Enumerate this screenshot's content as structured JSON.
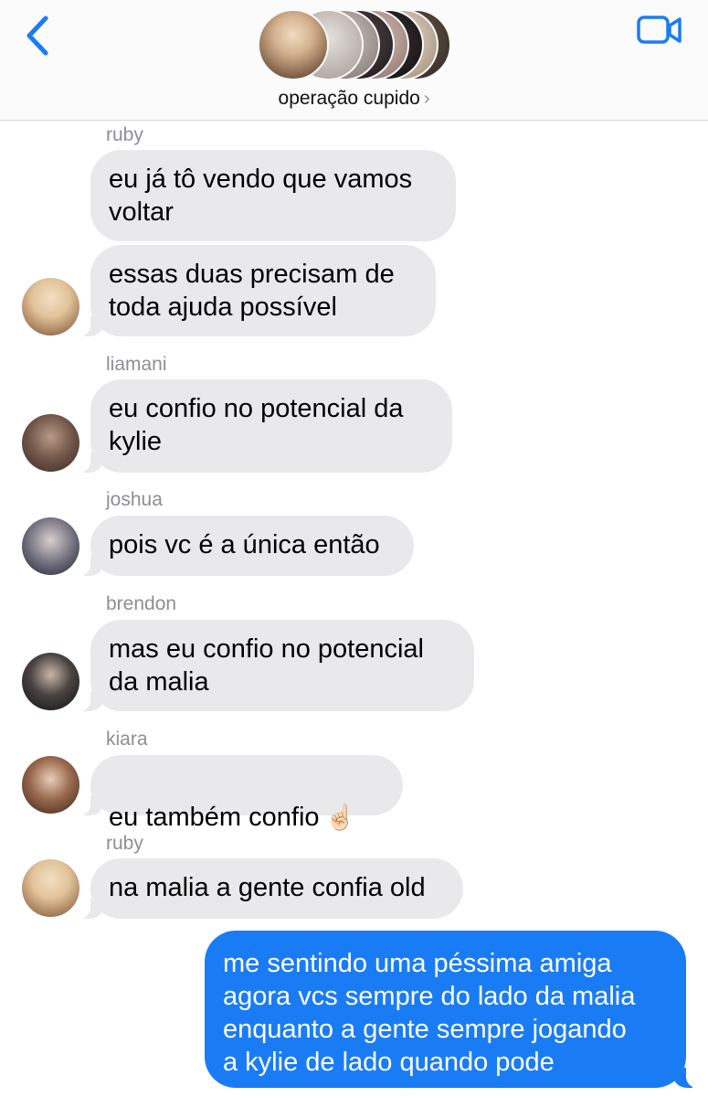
{
  "header": {
    "group_name": "operação cupido",
    "chevron": "›",
    "accent_color": "#1a7cf5",
    "back_icon": "chevron-left-icon",
    "video_icon": "video-camera-icon"
  },
  "messages": [
    {
      "sender": "ruby",
      "text": "eu já tô vendo que vamos\nvoltar"
    },
    {
      "sender": "",
      "text": "essas duas precisam de\ntoda ajuda possível"
    },
    {
      "sender": "liamani",
      "text": "eu confio no potencial da\nkylie"
    },
    {
      "sender": "joshua",
      "text": "pois vc é a única então"
    },
    {
      "sender": "brendon",
      "text": "mas eu confio no potencial\nda malia"
    },
    {
      "sender": "kiara",
      "text": "eu também confio",
      "emoji": "☝🏻"
    },
    {
      "sender": "ruby",
      "text": "na malia a gente confia old"
    },
    {
      "sender": "me",
      "text": "me sentindo uma péssima amiga\nagora vcs sempre do lado da malia\nenquanto a gente sempre jogando\na kylie de lado quando pode"
    }
  ],
  "colors": {
    "incoming_bubble": "#e9e9eb",
    "outgoing_bubble": "#1a7cf5",
    "sender_label": "#8e8e93"
  }
}
